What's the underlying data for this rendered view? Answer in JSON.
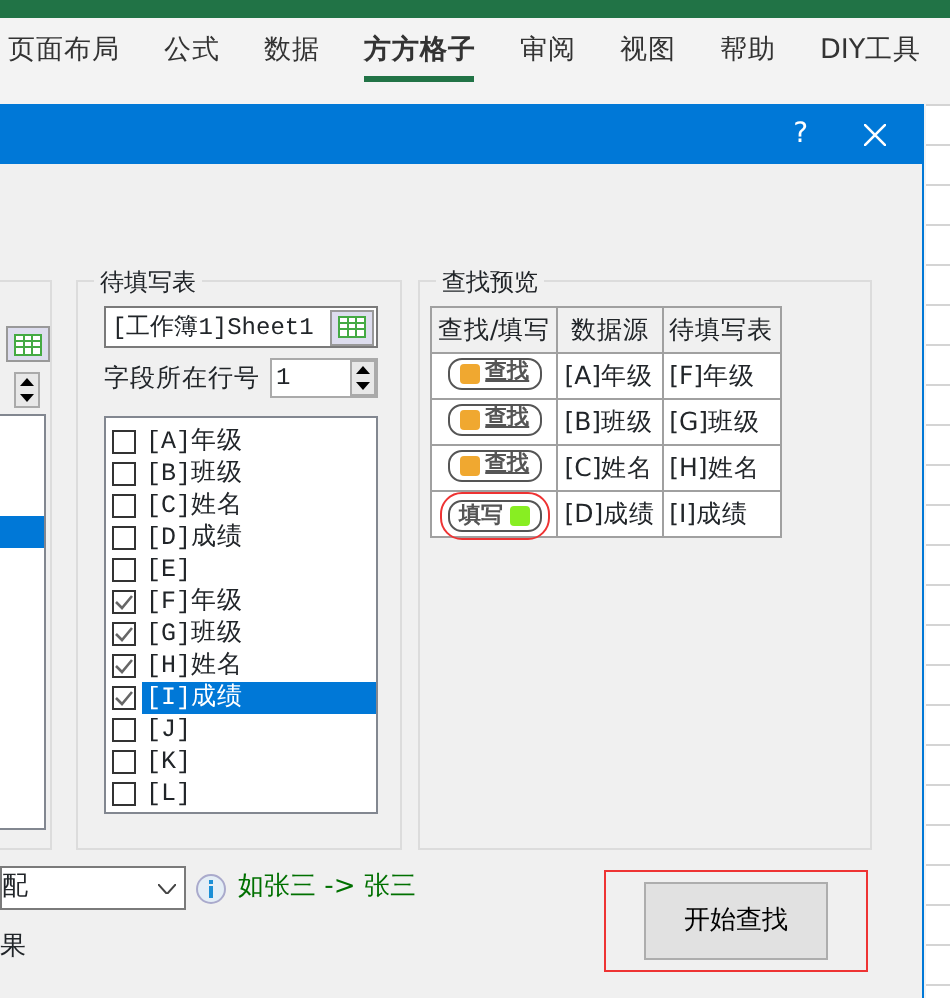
{
  "ribbon": {
    "tabs": [
      {
        "label": "页面布局",
        "selected": false
      },
      {
        "label": "公式",
        "selected": false
      },
      {
        "label": "数据",
        "selected": false
      },
      {
        "label": "方方格子",
        "selected": true
      },
      {
        "label": "审阅",
        "selected": false
      },
      {
        "label": "视图",
        "selected": false
      },
      {
        "label": "帮助",
        "selected": false
      },
      {
        "label": "DIY工具",
        "selected": false
      }
    ]
  },
  "dialog": {
    "help": "?",
    "left_list": {
      "rows": [
        {
          "selected": false
        },
        {
          "selected": false
        },
        {
          "selected": false
        },
        {
          "selected": true
        },
        {
          "selected": false
        },
        {
          "selected": false
        },
        {
          "selected": false
        },
        {
          "selected": false
        },
        {
          "selected": false
        },
        {
          "selected": false
        },
        {
          "selected": false
        },
        {
          "selected": false
        }
      ]
    },
    "target": {
      "title": "待填写表",
      "sheet": "[工作簿1]Sheet1",
      "row_label": "字段所在行号",
      "row_value": "1",
      "fields": [
        {
          "label": "[A]年级",
          "checked": false,
          "selected": false
        },
        {
          "label": "[B]班级",
          "checked": false,
          "selected": false
        },
        {
          "label": "[C]姓名",
          "checked": false,
          "selected": false
        },
        {
          "label": "[D]成绩",
          "checked": false,
          "selected": false
        },
        {
          "label": "[E]",
          "checked": false,
          "selected": false
        },
        {
          "label": "[F]年级",
          "checked": true,
          "selected": false
        },
        {
          "label": "[G]班级",
          "checked": true,
          "selected": false
        },
        {
          "label": "[H]姓名",
          "checked": true,
          "selected": false
        },
        {
          "label": "[I]成绩",
          "checked": true,
          "selected": true
        },
        {
          "label": "[J]",
          "checked": false,
          "selected": false
        },
        {
          "label": "[K]",
          "checked": false,
          "selected": false
        },
        {
          "label": "[L]",
          "checked": false,
          "selected": false
        }
      ]
    },
    "preview": {
      "title": "查找预览",
      "columns": [
        "查找/填写",
        "数据源",
        "待填写表"
      ],
      "rows": [
        {
          "action": {
            "kind": "find",
            "label": "查找",
            "color": "#f0a830"
          },
          "source": "[A]年级",
          "target": "[F]年级",
          "highlighted": false
        },
        {
          "action": {
            "kind": "find",
            "label": "查找",
            "color": "#f0a830"
          },
          "source": "[B]班级",
          "target": "[G]班级",
          "highlighted": false
        },
        {
          "action": {
            "kind": "find",
            "label": "查找",
            "color": "#f0a830"
          },
          "source": "[C]姓名",
          "target": "[H]姓名",
          "highlighted": false
        },
        {
          "action": {
            "kind": "fill",
            "label": "填写",
            "color": "#88ee22"
          },
          "source": "[D]成绩",
          "target": "[I]成绩",
          "highlighted": true
        }
      ]
    },
    "match_select": "配",
    "hint": "如张三 -> 张三",
    "result_label": "果",
    "start_button": {
      "label": "开始查找",
      "highlighted": true
    }
  }
}
